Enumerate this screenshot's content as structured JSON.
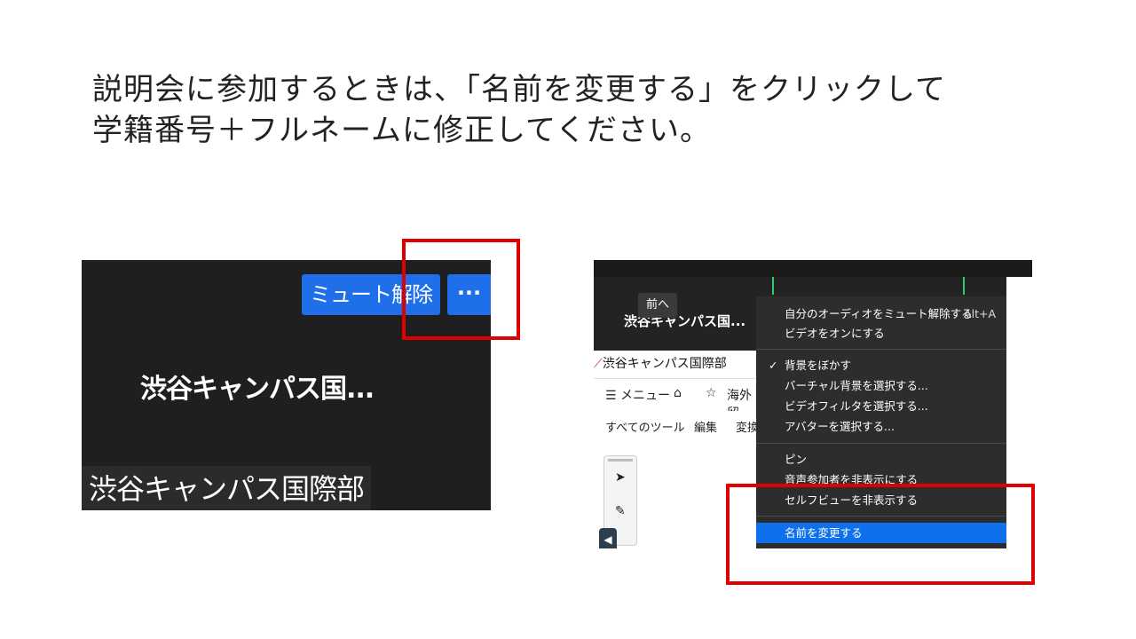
{
  "instruction": {
    "line1": "説明会に参加するときは、「名前を変更する」をクリックして",
    "line2": "学籍番号＋フルネームに修正してください。"
  },
  "left_panel": {
    "unmute_button": "ミュート解除",
    "more_button": "···",
    "participant_name_truncated": "渋谷キャンパス国...",
    "participant_label": "渋谷キャンパス国際部"
  },
  "right_panel": {
    "prev_tooltip": "前へ",
    "participant_name_truncated": "渋谷キャンパス国...",
    "participant_label": "渋谷キャンパス国際部",
    "pdf_toolbar": {
      "menu": "☰ メニュー",
      "home": "⌂",
      "star": "☆",
      "tab": "海外留"
    },
    "pdf_tabs": [
      "すべてのツール",
      "編集",
      "変換"
    ],
    "menu_items": [
      {
        "label": "自分のオーディオをミュート解除する",
        "shortcut": "Alt+A"
      },
      {
        "label": "ビデオをオンにする"
      },
      {
        "label": "背景をぼかす",
        "checked": "✓"
      },
      {
        "label": "バーチャル背景を選択する..."
      },
      {
        "label": "ビデオフィルタを選択する..."
      },
      {
        "label": "アバターを選択する..."
      },
      {
        "label": "ピン"
      },
      {
        "label": "音声参加者を非表示にする"
      },
      {
        "label": "セルフビューを非表示する"
      },
      {
        "label": "名前を変更する"
      }
    ]
  },
  "colors": {
    "highlight": "#e00000",
    "zoom_blue": "#1f6feb",
    "menu_bg": "#2d2d2d"
  }
}
